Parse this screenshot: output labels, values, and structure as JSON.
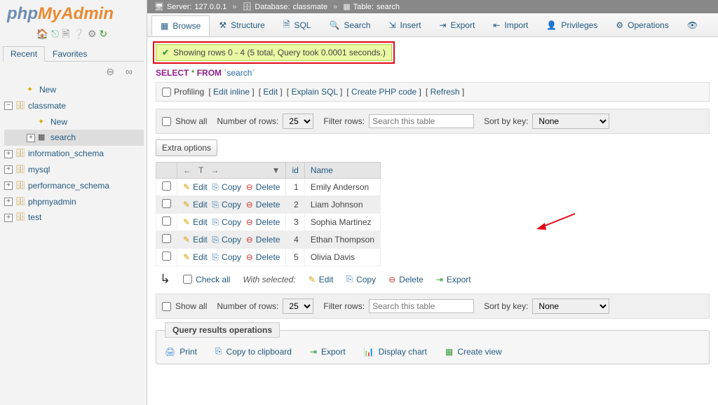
{
  "breadcrumb": {
    "server_label": "Server:",
    "server": "127.0.0.1",
    "db_label": "Database:",
    "db": "classmate",
    "table_label": "Table:",
    "table": "search"
  },
  "sidebar": {
    "tabs": {
      "recent": "Recent",
      "favorites": "Favorites"
    },
    "items": [
      {
        "label": "New",
        "type": "new",
        "indent": 1
      },
      {
        "label": "classmate",
        "type": "db",
        "expanded": true,
        "indent": 0
      },
      {
        "label": "New",
        "type": "new",
        "indent": 2
      },
      {
        "label": "search",
        "type": "table",
        "active": true,
        "indent": 2,
        "expander": true
      },
      {
        "label": "information_schema",
        "type": "db",
        "indent": 0,
        "expander": true
      },
      {
        "label": "mysql",
        "type": "db",
        "indent": 0,
        "expander": true
      },
      {
        "label": "performance_schema",
        "type": "db",
        "indent": 0,
        "expander": true
      },
      {
        "label": "phpmyadmin",
        "type": "db",
        "indent": 0,
        "expander": true
      },
      {
        "label": "test",
        "type": "db",
        "indent": 0,
        "expander": true
      }
    ]
  },
  "topnav": [
    {
      "label": "Browse",
      "active": true,
      "icon": "table"
    },
    {
      "label": "Structure",
      "icon": "struct"
    },
    {
      "label": "SQL",
      "icon": "sql"
    },
    {
      "label": "Search",
      "icon": "search"
    },
    {
      "label": "Insert",
      "icon": "insert"
    },
    {
      "label": "Export",
      "icon": "export"
    },
    {
      "label": "Import",
      "icon": "import"
    },
    {
      "label": "Privileges",
      "icon": "priv"
    },
    {
      "label": "Operations",
      "icon": "ops"
    }
  ],
  "success_msg": "Showing rows 0 - 4 (5 total, Query took 0.0001 seconds.)",
  "sql_query": {
    "select": "SELECT",
    "star": "*",
    "from": "FROM",
    "backtick": "`",
    "table": "search"
  },
  "linkbar": {
    "profiling": "Profiling",
    "edit_inline": "Edit inline",
    "edit": "Edit",
    "explain": "Explain SQL",
    "php": "Create PHP code",
    "refresh": "Refresh"
  },
  "controls": {
    "show_all": "Show all",
    "num_rows_label": "Number of rows:",
    "num_rows_value": "25",
    "filter_label": "Filter rows:",
    "filter_placeholder": "Search this table",
    "sort_label": "Sort by key:",
    "sort_value": "None"
  },
  "extra_options": "Extra options",
  "columns": [
    "id",
    "Name"
  ],
  "actions": {
    "edit": "Edit",
    "copy": "Copy",
    "delete": "Delete"
  },
  "rows": [
    {
      "id": 1,
      "name": "Emily Anderson"
    },
    {
      "id": 2,
      "name": "Liam Johnson"
    },
    {
      "id": 3,
      "name": "Sophia Martinez"
    },
    {
      "id": 4,
      "name": "Ethan Thompson"
    },
    {
      "id": 5,
      "name": "Olivia Davis"
    }
  ],
  "underbar": {
    "check_all": "Check all",
    "with_selected": "With selected:",
    "edit": "Edit",
    "copy": "Copy",
    "delete": "Delete",
    "export": "Export"
  },
  "results_ops": {
    "title": "Query results operations",
    "print": "Print",
    "copy": "Copy to clipboard",
    "export": "Export",
    "chart": "Display chart",
    "view": "Create view"
  }
}
